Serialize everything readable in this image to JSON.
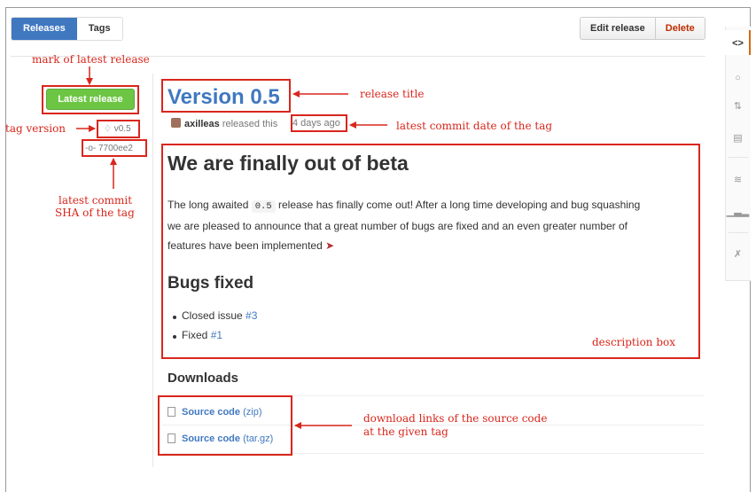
{
  "tabs": [
    {
      "label": "Releases",
      "active": true
    },
    {
      "label": "Tags",
      "active": false
    }
  ],
  "actions": {
    "edit_label": "Edit release",
    "delete_label": "Delete"
  },
  "sidebar_icons": [
    "code-icon",
    "issue-icon",
    "pull-request-icon",
    "wiki-icon",
    "pulse-icon",
    "graphs-icon",
    "settings-icon"
  ],
  "release": {
    "latest_label": "Latest release",
    "tag": "v0.5",
    "sha": "7700ee2",
    "title": "Version 0.5",
    "author": "axilleas",
    "released_text": "released this",
    "date": "4 days ago",
    "body_heading": "We are finally out of beta",
    "para_pre": "The long awaited",
    "para_code": "0.5",
    "para_line1_rest": "release has finally come out! After a long time developing and bug squashing",
    "para_line2": "we are pleased to announce that a great number of bugs are fixed and an even greater number of",
    "para_line3": "features have been implemented",
    "bugs_heading": "Bugs fixed",
    "bullets": [
      {
        "text": "Closed issue",
        "link": "#3"
      },
      {
        "text": "Fixed",
        "link": "#1"
      }
    ]
  },
  "downloads": {
    "heading": "Downloads",
    "items": [
      {
        "name": "Source code",
        "format": "(zip)"
      },
      {
        "name": "Source code",
        "format": "(tar.gz)"
      }
    ]
  },
  "annotations": {
    "latest_mark": "mark of latest release",
    "tag_version": "tag version",
    "sha_line1": "latest commit",
    "sha_line2": "SHA of the tag",
    "release_title": "release title",
    "commit_date": "latest commit date of the tag",
    "description_box": "description box",
    "download_line1": "download links of the source code",
    "download_line2": "at the given tag"
  },
  "colors": {
    "accent": "#4078c0",
    "latest_green": "#6cc644",
    "annotation_red": "#d9261c",
    "delete_red": "#bd2c00"
  }
}
